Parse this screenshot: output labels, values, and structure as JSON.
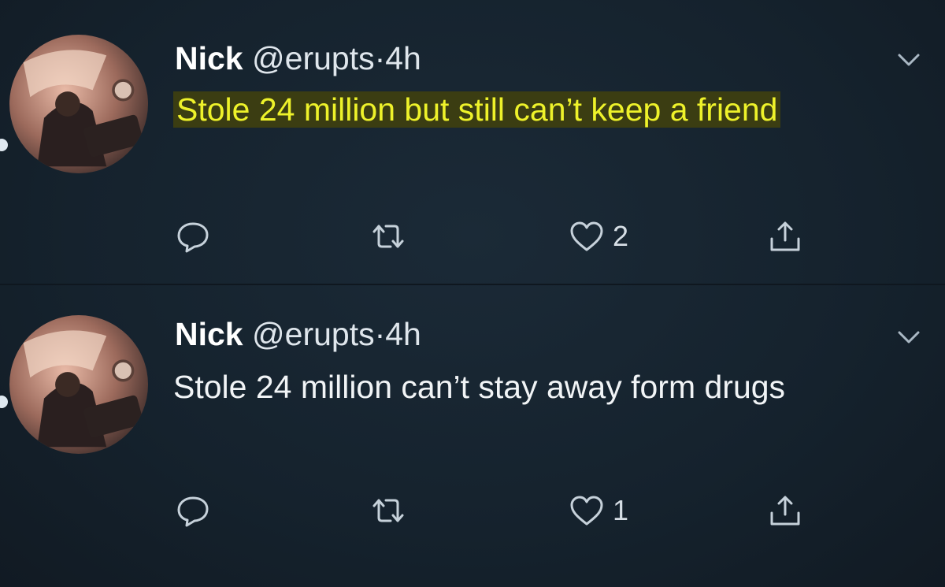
{
  "tweets": [
    {
      "name": "Nick",
      "handle": "@erupts",
      "separator": "·",
      "time": "4h",
      "text": "Stole 24 million but still can’t keep a friend",
      "highlighted": true,
      "like_count": "2",
      "highlight_color": "#eef22a"
    },
    {
      "name": "Nick",
      "handle": "@erupts",
      "separator": "·",
      "time": "4h",
      "text": "Stole 24 million can’t stay away form drugs",
      "highlighted": false,
      "like_count": "1"
    }
  ],
  "icons": {
    "reply": "reply-icon",
    "retweet": "retweet-icon",
    "like": "heart-icon",
    "share": "share-icon",
    "menu": "chevron-down-icon"
  },
  "colors": {
    "background": "#15202b",
    "icon": "#c6d1da"
  }
}
